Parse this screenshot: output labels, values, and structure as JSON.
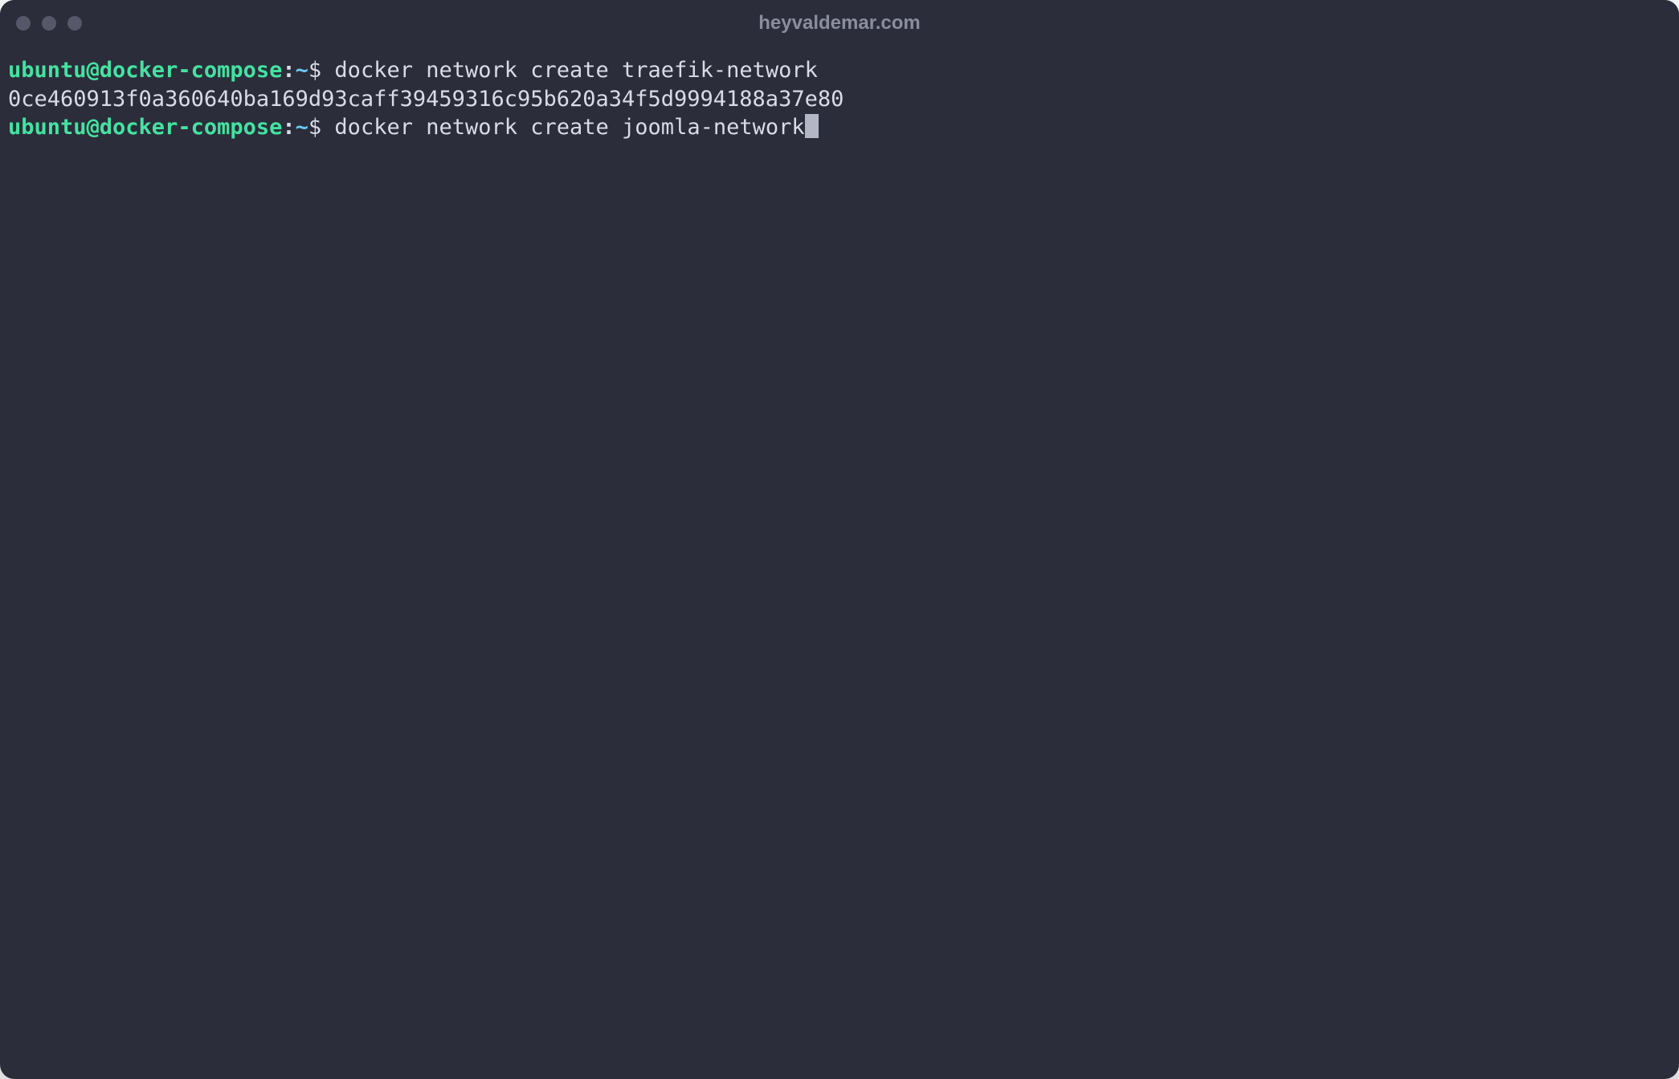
{
  "window": {
    "title": "heyvaldemar.com"
  },
  "prompt": {
    "user_host": "ubuntu@docker-compose",
    "colon": ":",
    "path": "~",
    "symbol": "$"
  },
  "lines": {
    "line1_command": " docker network create traefik-network",
    "line2_output": "0ce460913f0a360640ba169d93caff39459316c95b620a34f5d9994188a37e80",
    "line3_command": " docker network create joomla-network"
  }
}
